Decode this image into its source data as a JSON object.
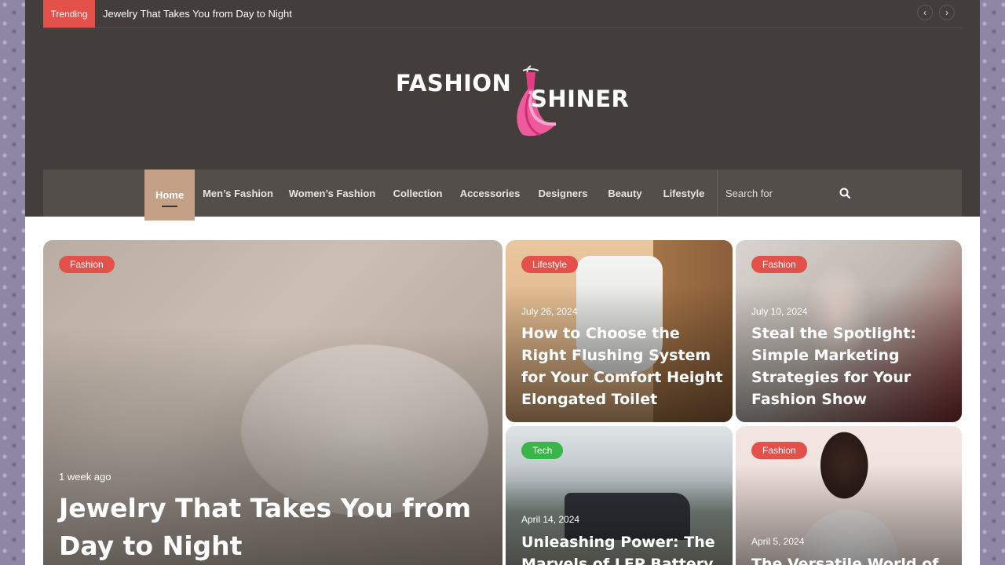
{
  "topbar": {
    "trending_label": "Trending",
    "trending_headline": "Jewelry That Takes You from Day to Night",
    "prev_icon": "chevron-left-icon",
    "next_icon": "chevron-right-icon"
  },
  "logo": {
    "word1": "FASHION",
    "word2": "SHINER"
  },
  "nav": {
    "items": [
      {
        "label": "Home",
        "active": true
      },
      {
        "label": "Men’s Fashion"
      },
      {
        "label": "Women’s Fashion"
      },
      {
        "label": "Collection"
      },
      {
        "label": "Accessories"
      },
      {
        "label": "Designers"
      },
      {
        "label": "Beauty"
      },
      {
        "label": "Lifestyle"
      }
    ],
    "search_placeholder": "Search for",
    "search_icon": "search-icon"
  },
  "colors": {
    "header_bg": "#433e3b",
    "nav_bg": "#544e4a",
    "active_nav": "#c4a186",
    "badge_red": "#e4514a",
    "badge_green": "#39b54a"
  },
  "posts": [
    {
      "category": "Fashion",
      "date": "1 week ago",
      "title": "Jewelry That Takes You from Day to Night"
    },
    {
      "category": "Lifestyle",
      "date": "July 26, 2024",
      "title": "How to Choose the Right Flushing System for Your Comfort Height Elongated Toilet"
    },
    {
      "category": "Fashion",
      "date": "July 10, 2024",
      "title": "Steal the Spotlight: Simple Marketing Strategies for Your Fashion Show"
    },
    {
      "category": "Tech",
      "date": "April 14, 2024",
      "title": "Unleashing Power: The Marvels of LFP Battery"
    },
    {
      "category": "Fashion",
      "date": "April 5, 2024",
      "title": "The Versatile World of"
    }
  ]
}
